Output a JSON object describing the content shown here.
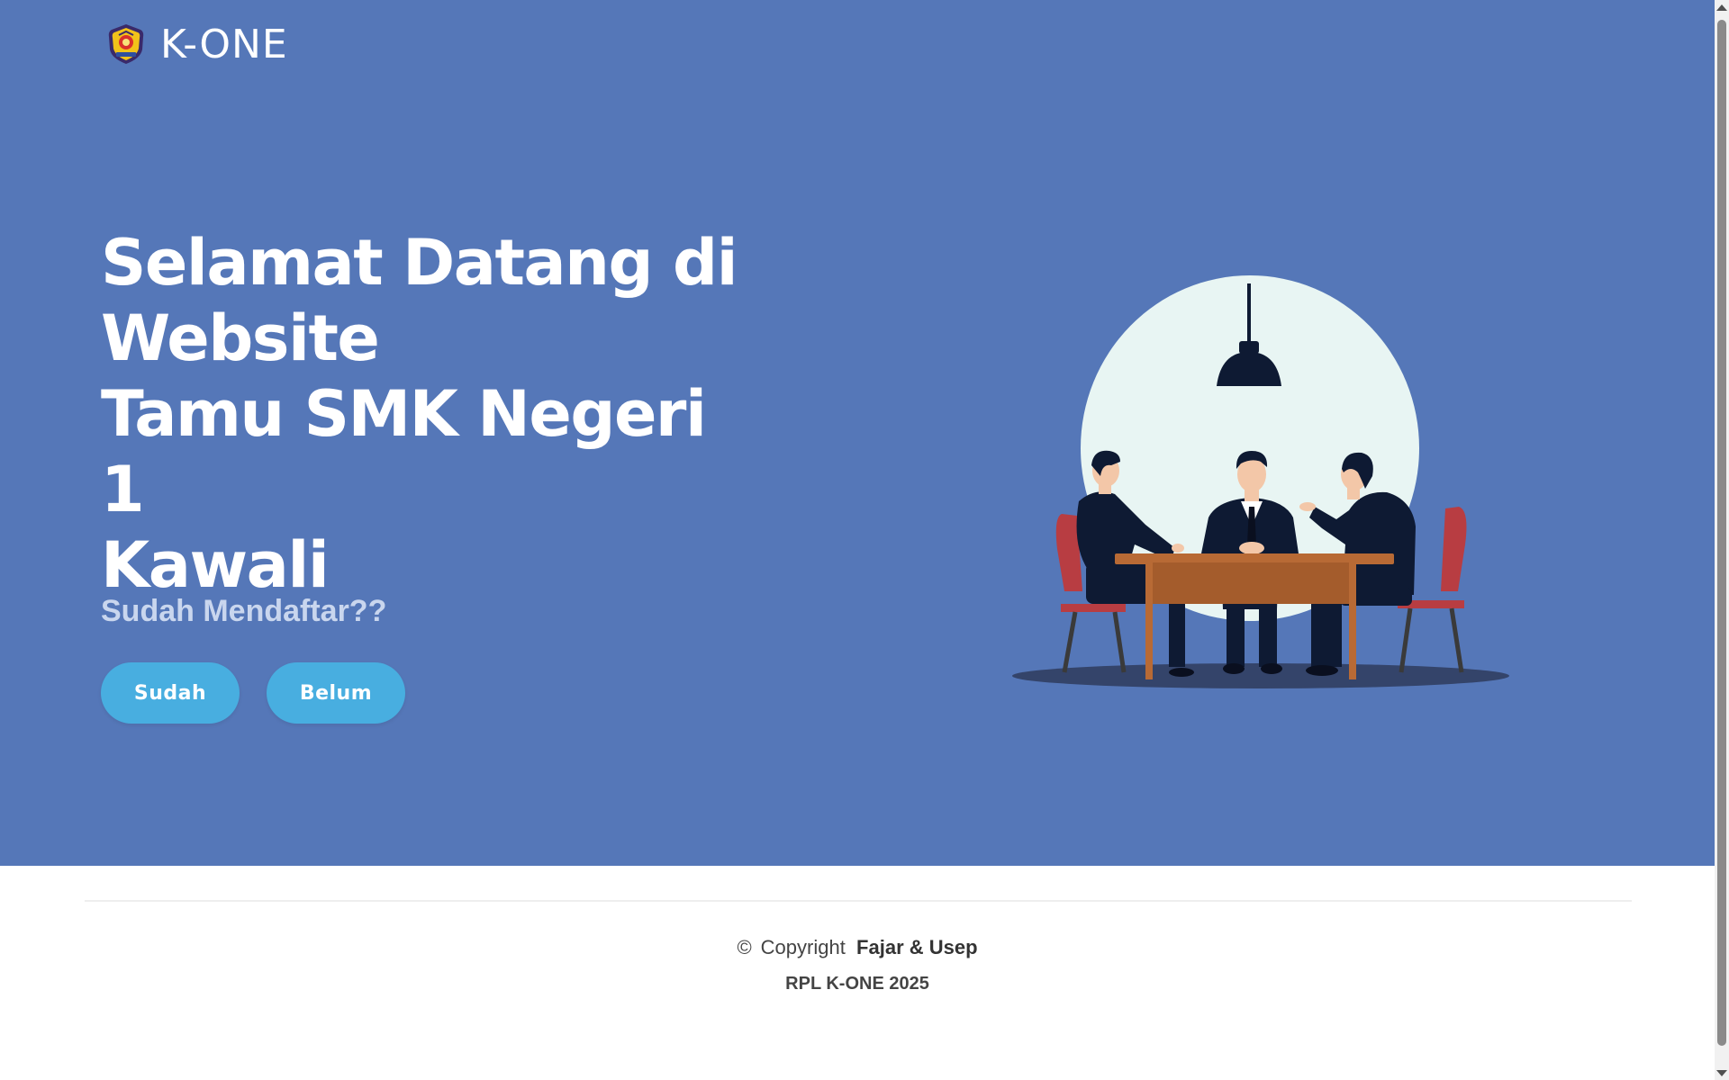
{
  "brand": {
    "name": "K-ONE",
    "logo_icon": "school-emblem-icon"
  },
  "hero": {
    "title_lines": [
      "Selamat Datang di",
      "Website",
      "Tamu SMK Negeri 1",
      "Kawali"
    ],
    "question": "Sudah Mendaftar??",
    "buttons": {
      "sudah_label": "Sudah",
      "belum_label": "Belum"
    },
    "illustration_icon": "business-meeting-illustration",
    "colors": {
      "background": "#5577b8",
      "button": "#48aee0"
    }
  },
  "footer": {
    "copyright_symbol": "©",
    "copyright_prefix": "Copyright",
    "authors": "Fajar & Usep",
    "subline": "RPL K-ONE 2025"
  }
}
